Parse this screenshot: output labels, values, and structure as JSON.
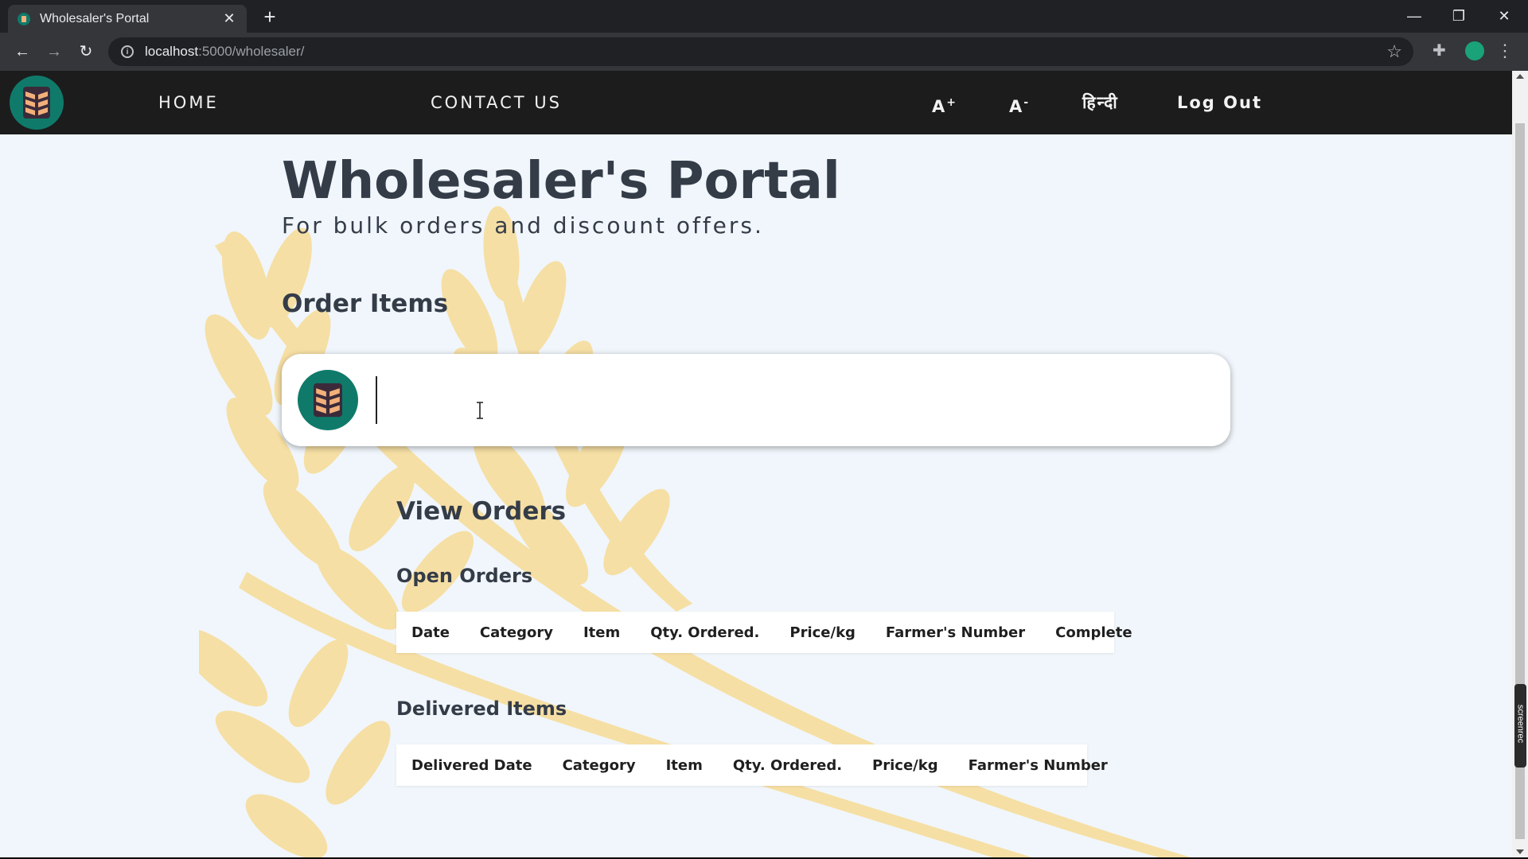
{
  "browser": {
    "tab_title": "Wholesaler's Portal",
    "url_host": "localhost",
    "url_path": ":5000/wholesaler/"
  },
  "nav": {
    "home": "HOME",
    "contact": "CONTACT US",
    "font_increase": "A",
    "font_increase_sup": "+",
    "font_decrease": "A",
    "font_decrease_sup": "-",
    "language": "हिन्दी",
    "logout": "Log Out"
  },
  "header": {
    "title": "Wholesaler's Portal",
    "subtitle": "For bulk orders and discount offers."
  },
  "order_items": {
    "title": "Order Items",
    "search_value": ""
  },
  "view_orders": {
    "title": "View Orders",
    "open_orders": {
      "title": "Open Orders",
      "columns": [
        "Date",
        "Category",
        "Item",
        "Qty. Ordered.",
        "Price/kg",
        "Farmer's Number",
        "Complete"
      ]
    },
    "delivered_items": {
      "title": "Delivered Items",
      "columns": [
        "Delivered Date",
        "Category",
        "Item",
        "Qty. Ordered.",
        "Price/kg",
        "Farmer's Number"
      ]
    }
  },
  "overlay": {
    "screenrec": "screenrec"
  },
  "colors": {
    "nav_bg": "#1c1c1c",
    "logo_teal": "#0f7a6a",
    "logo_orange": "#f3b07a",
    "title_text": "#343c48",
    "page_bg": "#f0f6fb",
    "wheat": "#f6dfa4"
  },
  "icons": [
    "wheat-logo-icon",
    "info-icon",
    "star-icon",
    "extension-icon",
    "profile-icon",
    "menu-icon",
    "back-icon",
    "forward-icon",
    "reload-icon",
    "close-icon",
    "plus-icon",
    "text-cursor-icon"
  ]
}
